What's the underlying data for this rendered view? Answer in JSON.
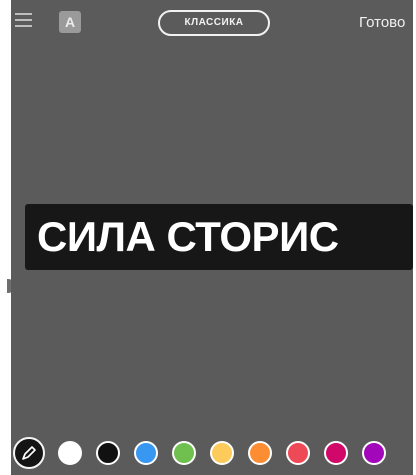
{
  "toolbar": {
    "menu_icon": "menu-icon",
    "text_style_label": "A",
    "mode_label": "КЛАССИКА",
    "done_label": "Готово"
  },
  "canvas": {
    "background_color": "#5b5b5b",
    "caption": "СИЛА СТОРИС",
    "caption_text_color": "#ffffff",
    "caption_background_color": "#171717"
  },
  "palette": {
    "pen_icon": "pen-icon",
    "colors": [
      {
        "name": "white",
        "hex": "#ffffff"
      },
      {
        "name": "black",
        "hex": "#111111"
      },
      {
        "name": "blue",
        "hex": "#3897f0"
      },
      {
        "name": "green",
        "hex": "#70c050"
      },
      {
        "name": "yellow",
        "hex": "#fdcb5c"
      },
      {
        "name": "orange",
        "hex": "#fd8d32"
      },
      {
        "name": "red",
        "hex": "#ed4956"
      },
      {
        "name": "magenta",
        "hex": "#d10869"
      },
      {
        "name": "purple",
        "hex": "#a307ba"
      }
    ]
  }
}
